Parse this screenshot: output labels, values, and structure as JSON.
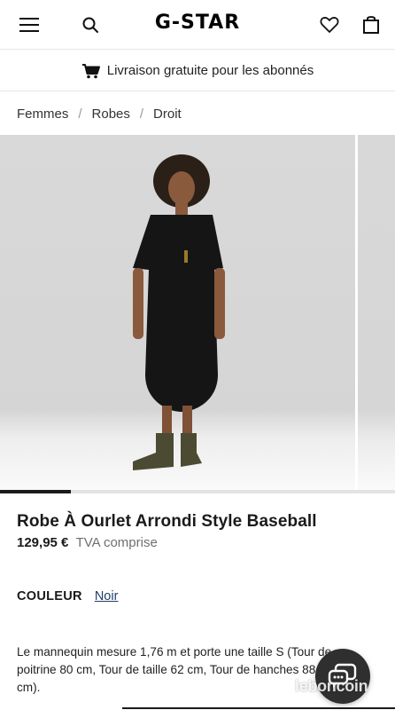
{
  "header": {
    "brand": "G-STAR",
    "icons": [
      "menu-icon",
      "search-icon",
      "heart-icon",
      "shopping-bag-icon"
    ]
  },
  "promo": {
    "text": "Livraison gratuite pour les abonnés",
    "icon": "cart-icon"
  },
  "breadcrumb": {
    "items": [
      "Femmes",
      "Robes",
      "Droit"
    ],
    "separator": "/"
  },
  "gallery": {
    "current_image": 1,
    "progress": 0.18,
    "image_subject": "product-photo-model-black-dress"
  },
  "product": {
    "title": "Robe À Ourlet Arrondi Style Baseball",
    "price": "129,95 €",
    "tax_note": "TVA comprise",
    "color_label": "COULEUR",
    "color_value": "Noir",
    "description": "Le mannequin mesure 1,76 m et porte une taille S (Tour de poitrine 80 cm, Tour de taille 62 cm, Tour de hanches 88 cm)."
  },
  "chat": {
    "icon": "chat-bubbles-icon"
  },
  "watermark": {
    "text": "leboncoin"
  },
  "colors": {
    "text": "#1a1a1a",
    "link": "#1f3f6b",
    "muted": "#6f6f6f",
    "divider": "#e6e6e6",
    "chat_bg": "#2f2f2f"
  }
}
